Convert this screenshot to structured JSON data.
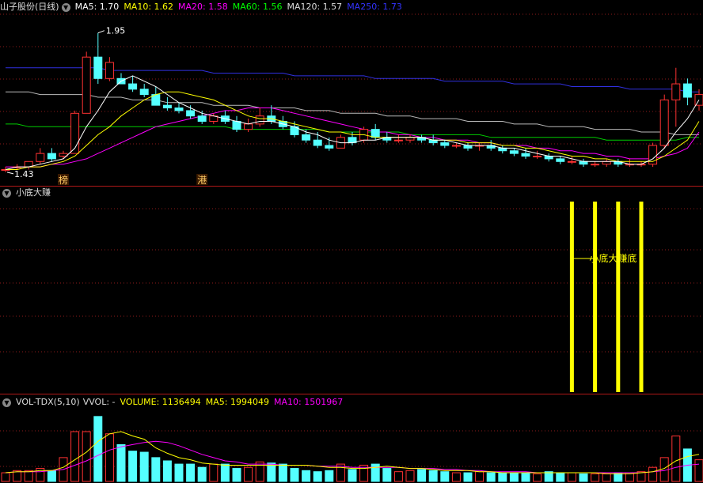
{
  "main_panel": {
    "title": "山子股份(日线)",
    "indicators": [
      {
        "label": "MA5: 1.70",
        "color": "#ffffff"
      },
      {
        "label": "MA10: 1.62",
        "color": "#ffff00"
      },
      {
        "label": "MA20: 1.58",
        "color": "#ff00ff"
      },
      {
        "label": "MA60: 1.56",
        "color": "#00ff00"
      },
      {
        "label": "MA120: 1.57",
        "color": "#dddddd"
      },
      {
        "label": "MA250: 1.73",
        "color": "#3333ff"
      }
    ],
    "high_label": "1.95",
    "low_label": "1.43",
    "markers": [
      {
        "text": "榜"
      },
      {
        "text": "港"
      }
    ]
  },
  "signal_panel": {
    "title": "小底大赚",
    "signal_text": "小底大赚底"
  },
  "volume_panel": {
    "title": "VOL-TDX(5,10)",
    "indicators": [
      {
        "label": "VVOL: -",
        "color": "#dddddd"
      },
      {
        "label": "VOLUME: 1136494",
        "color": "#ffff00"
      },
      {
        "label": "MA5: 1994049",
        "color": "#ffff00"
      },
      {
        "label": "MA10: 1501967",
        "color": "#ff00ff"
      }
    ]
  },
  "colors": {
    "up": "#ff3232",
    "down": "#54ffff",
    "grid": "#8b1a1a",
    "signal": "#ffff00"
  },
  "chart_data": {
    "type": "candlestick",
    "candles": [
      [
        1.44,
        1.45,
        1.43,
        1.44
      ],
      [
        1.45,
        1.46,
        1.44,
        1.45
      ],
      [
        1.45,
        1.47,
        1.44,
        1.47
      ],
      [
        1.47,
        1.52,
        1.46,
        1.5
      ],
      [
        1.5,
        1.52,
        1.47,
        1.48
      ],
      [
        1.49,
        1.51,
        1.48,
        1.5
      ],
      [
        1.5,
        1.66,
        1.5,
        1.65
      ],
      [
        1.65,
        1.88,
        1.65,
        1.86
      ],
      [
        1.86,
        1.95,
        1.76,
        1.78
      ],
      [
        1.78,
        1.86,
        1.77,
        1.84
      ],
      [
        1.78,
        1.8,
        1.76,
        1.76
      ],
      [
        1.76,
        1.79,
        1.73,
        1.74
      ],
      [
        1.74,
        1.76,
        1.71,
        1.72
      ],
      [
        1.72,
        1.75,
        1.68,
        1.68
      ],
      [
        1.68,
        1.71,
        1.66,
        1.67
      ],
      [
        1.67,
        1.69,
        1.65,
        1.66
      ],
      [
        1.66,
        1.68,
        1.63,
        1.64
      ],
      [
        1.64,
        1.66,
        1.61,
        1.62
      ],
      [
        1.62,
        1.65,
        1.61,
        1.64
      ],
      [
        1.64,
        1.66,
        1.61,
        1.62
      ],
      [
        1.62,
        1.64,
        1.58,
        1.59
      ],
      [
        1.59,
        1.63,
        1.58,
        1.61
      ],
      [
        1.61,
        1.67,
        1.6,
        1.64
      ],
      [
        1.64,
        1.68,
        1.61,
        1.62
      ],
      [
        1.62,
        1.64,
        1.59,
        1.6
      ],
      [
        1.6,
        1.62,
        1.56,
        1.57
      ],
      [
        1.57,
        1.59,
        1.54,
        1.55
      ],
      [
        1.55,
        1.58,
        1.52,
        1.53
      ],
      [
        1.53,
        1.56,
        1.51,
        1.52
      ],
      [
        1.52,
        1.57,
        1.52,
        1.56
      ],
      [
        1.56,
        1.58,
        1.53,
        1.54
      ],
      [
        1.55,
        1.6,
        1.54,
        1.59
      ],
      [
        1.59,
        1.61,
        1.55,
        1.56
      ],
      [
        1.56,
        1.58,
        1.54,
        1.55
      ],
      [
        1.55,
        1.57,
        1.54,
        1.55
      ],
      [
        1.55,
        1.57,
        1.54,
        1.56
      ],
      [
        1.56,
        1.57,
        1.54,
        1.55
      ],
      [
        1.55,
        1.57,
        1.53,
        1.54
      ],
      [
        1.54,
        1.55,
        1.52,
        1.53
      ],
      [
        1.53,
        1.54,
        1.52,
        1.53
      ],
      [
        1.53,
        1.54,
        1.51,
        1.52
      ],
      [
        1.53,
        1.54,
        1.51,
        1.53
      ],
      [
        1.53,
        1.55,
        1.51,
        1.52
      ],
      [
        1.52,
        1.53,
        1.5,
        1.51
      ],
      [
        1.51,
        1.52,
        1.49,
        1.5
      ],
      [
        1.5,
        1.52,
        1.48,
        1.49
      ],
      [
        1.49,
        1.51,
        1.48,
        1.49
      ],
      [
        1.49,
        1.5,
        1.47,
        1.48
      ],
      [
        1.48,
        1.49,
        1.46,
        1.47
      ],
      [
        1.47,
        1.49,
        1.46,
        1.47
      ],
      [
        1.47,
        1.48,
        1.45,
        1.46
      ],
      [
        1.46,
        1.47,
        1.45,
        1.46
      ],
      [
        1.46,
        1.48,
        1.45,
        1.47
      ],
      [
        1.47,
        1.48,
        1.45,
        1.46
      ],
      [
        1.46,
        1.48,
        1.45,
        1.46
      ],
      [
        1.46,
        1.47,
        1.45,
        1.46
      ],
      [
        1.46,
        1.54,
        1.45,
        1.53
      ],
      [
        1.53,
        1.72,
        1.52,
        1.7
      ],
      [
        1.7,
        1.82,
        1.6,
        1.76
      ],
      [
        1.76,
        1.78,
        1.68,
        1.71
      ],
      [
        1.68,
        1.74,
        1.66,
        1.72
      ]
    ],
    "ma5": [
      1.44,
      1.45,
      1.45,
      1.46,
      1.47,
      1.48,
      1.52,
      1.6,
      1.66,
      1.73,
      1.77,
      1.79,
      1.77,
      1.75,
      1.72,
      1.69,
      1.67,
      1.65,
      1.64,
      1.63,
      1.62,
      1.61,
      1.62,
      1.62,
      1.61,
      1.6,
      1.58,
      1.57,
      1.55,
      1.54,
      1.54,
      1.55,
      1.55,
      1.56,
      1.56,
      1.56,
      1.56,
      1.55,
      1.55,
      1.54,
      1.53,
      1.53,
      1.53,
      1.52,
      1.52,
      1.51,
      1.5,
      1.49,
      1.49,
      1.48,
      1.47,
      1.47,
      1.47,
      1.47,
      1.46,
      1.46,
      1.48,
      1.52,
      1.58,
      1.63,
      1.7
    ],
    "ma10": [
      1.44,
      1.44,
      1.45,
      1.45,
      1.46,
      1.47,
      1.49,
      1.53,
      1.57,
      1.6,
      1.64,
      1.67,
      1.7,
      1.72,
      1.73,
      1.73,
      1.72,
      1.71,
      1.7,
      1.68,
      1.66,
      1.64,
      1.63,
      1.63,
      1.62,
      1.61,
      1.6,
      1.59,
      1.58,
      1.58,
      1.57,
      1.57,
      1.56,
      1.56,
      1.56,
      1.56,
      1.56,
      1.55,
      1.55,
      1.55,
      1.54,
      1.54,
      1.54,
      1.53,
      1.53,
      1.52,
      1.52,
      1.51,
      1.5,
      1.49,
      1.49,
      1.48,
      1.48,
      1.47,
      1.47,
      1.47,
      1.47,
      1.49,
      1.52,
      1.55,
      1.62
    ],
    "ma20": [
      1.45,
      1.45,
      1.45,
      1.45,
      1.46,
      1.46,
      1.47,
      1.48,
      1.5,
      1.52,
      1.54,
      1.56,
      1.58,
      1.6,
      1.61,
      1.62,
      1.63,
      1.64,
      1.65,
      1.66,
      1.66,
      1.67,
      1.67,
      1.67,
      1.66,
      1.65,
      1.64,
      1.63,
      1.62,
      1.61,
      1.6,
      1.59,
      1.58,
      1.58,
      1.57,
      1.57,
      1.56,
      1.56,
      1.55,
      1.55,
      1.55,
      1.54,
      1.54,
      1.53,
      1.53,
      1.53,
      1.52,
      1.52,
      1.51,
      1.51,
      1.5,
      1.5,
      1.49,
      1.49,
      1.48,
      1.48,
      1.48,
      1.49,
      1.5,
      1.52,
      1.58
    ],
    "ma60": [
      1.61,
      1.61,
      1.6,
      1.6,
      1.6,
      1.6,
      1.6,
      1.6,
      1.6,
      1.6,
      1.6,
      1.6,
      1.6,
      1.6,
      1.6,
      1.6,
      1.6,
      1.6,
      1.6,
      1.6,
      1.59,
      1.59,
      1.59,
      1.59,
      1.59,
      1.59,
      1.59,
      1.59,
      1.58,
      1.58,
      1.58,
      1.58,
      1.58,
      1.58,
      1.58,
      1.57,
      1.57,
      1.57,
      1.57,
      1.57,
      1.57,
      1.57,
      1.56,
      1.56,
      1.56,
      1.56,
      1.56,
      1.56,
      1.56,
      1.56,
      1.56,
      1.56,
      1.55,
      1.55,
      1.55,
      1.55,
      1.55,
      1.55,
      1.55,
      1.56,
      1.56
    ],
    "ma120": [
      1.73,
      1.73,
      1.73,
      1.72,
      1.72,
      1.72,
      1.72,
      1.72,
      1.71,
      1.71,
      1.71,
      1.7,
      1.7,
      1.7,
      1.69,
      1.69,
      1.69,
      1.69,
      1.68,
      1.68,
      1.68,
      1.68,
      1.67,
      1.67,
      1.67,
      1.67,
      1.66,
      1.66,
      1.66,
      1.65,
      1.65,
      1.65,
      1.65,
      1.64,
      1.64,
      1.64,
      1.63,
      1.63,
      1.63,
      1.63,
      1.62,
      1.62,
      1.62,
      1.62,
      1.61,
      1.61,
      1.61,
      1.6,
      1.6,
      1.6,
      1.6,
      1.59,
      1.59,
      1.59,
      1.59,
      1.58,
      1.58,
      1.58,
      1.57,
      1.57,
      1.57
    ],
    "ma250": [
      1.82,
      1.82,
      1.82,
      1.82,
      1.82,
      1.82,
      1.82,
      1.82,
      1.82,
      1.81,
      1.81,
      1.81,
      1.81,
      1.81,
      1.81,
      1.81,
      1.81,
      1.81,
      1.8,
      1.8,
      1.8,
      1.8,
      1.8,
      1.8,
      1.8,
      1.79,
      1.79,
      1.79,
      1.79,
      1.79,
      1.79,
      1.79,
      1.78,
      1.78,
      1.78,
      1.78,
      1.78,
      1.78,
      1.77,
      1.77,
      1.77,
      1.77,
      1.77,
      1.77,
      1.76,
      1.76,
      1.76,
      1.76,
      1.76,
      1.75,
      1.75,
      1.75,
      1.75,
      1.75,
      1.74,
      1.74,
      1.74,
      1.74,
      1.74,
      1.73,
      1.73
    ],
    "volume": [
      0.8,
      1.0,
      1.0,
      1.2,
      1.0,
      2.2,
      4.6,
      4.6,
      6.0,
      4.4,
      3.4,
      2.8,
      2.7,
      2.2,
      1.9,
      1.6,
      1.6,
      1.3,
      1.6,
      1.6,
      1.2,
      1.3,
      1.8,
      1.7,
      1.6,
      1.2,
      1.0,
      0.9,
      1.0,
      1.6,
      1.1,
      1.5,
      1.6,
      1.2,
      0.9,
      1.0,
      1.1,
      1.0,
      0.9,
      0.8,
      0.8,
      0.9,
      0.8,
      0.8,
      0.8,
      0.8,
      0.7,
      0.9,
      0.8,
      0.8,
      0.7,
      0.7,
      0.7,
      0.8,
      0.8,
      0.9,
      1.3,
      2.2,
      4.2,
      3.0,
      2.0
    ],
    "volume_ma5": [
      0.8,
      0.9,
      0.9,
      1.0,
      1.0,
      1.3,
      2.0,
      2.7,
      3.7,
      4.4,
      4.6,
      4.2,
      3.9,
      3.1,
      2.6,
      2.2,
      2.0,
      1.7,
      1.6,
      1.5,
      1.5,
      1.5,
      1.5,
      1.5,
      1.5,
      1.5,
      1.5,
      1.4,
      1.3,
      1.3,
      1.2,
      1.2,
      1.3,
      1.4,
      1.3,
      1.2,
      1.2,
      1.1,
      1.0,
      1.0,
      1.0,
      0.9,
      0.9,
      0.8,
      0.8,
      0.8,
      0.8,
      0.8,
      0.8,
      0.8,
      0.8,
      0.8,
      0.7,
      0.7,
      0.7,
      0.8,
      0.9,
      1.2,
      1.9,
      2.3,
      2.5
    ],
    "volume_ma10": [
      0.8,
      0.9,
      0.9,
      0.9,
      1.0,
      1.1,
      1.5,
      1.9,
      2.4,
      2.9,
      3.2,
      3.4,
      3.6,
      3.7,
      3.6,
      3.3,
      2.9,
      2.5,
      2.2,
      1.9,
      1.8,
      1.6,
      1.6,
      1.6,
      1.5,
      1.5,
      1.5,
      1.4,
      1.4,
      1.4,
      1.3,
      1.3,
      1.3,
      1.3,
      1.3,
      1.2,
      1.2,
      1.2,
      1.1,
      1.1,
      1.0,
      1.0,
      0.9,
      0.9,
      0.9,
      0.9,
      0.8,
      0.8,
      0.8,
      0.8,
      0.8,
      0.8,
      0.8,
      0.8,
      0.8,
      0.8,
      0.9,
      1.0,
      1.3,
      1.5,
      1.6
    ],
    "signal_indices": [
      49,
      51,
      53,
      55
    ],
    "price_range": [
      1.4,
      2.02
    ],
    "volume_max": 6.5
  }
}
